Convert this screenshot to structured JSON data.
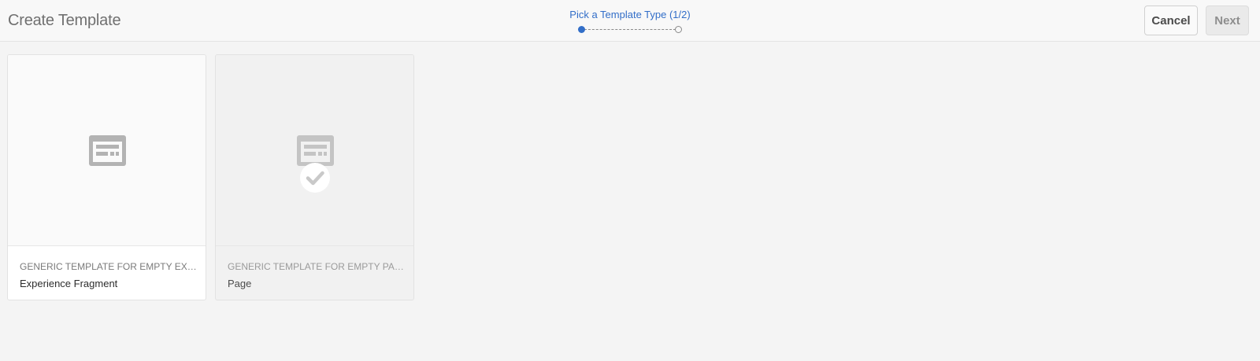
{
  "header": {
    "title": "Create Template",
    "step_label": "Pick a Template Type (1/2)",
    "steps": [
      "completed",
      "pending"
    ],
    "cancel_label": "Cancel",
    "next_label": "Next"
  },
  "cards": [
    {
      "icon": "template-icon",
      "subtitle": "GENERIC TEMPLATE FOR EMPTY EXPER...",
      "name": "Experience Fragment",
      "selected": false
    },
    {
      "icon": "template-icon",
      "subtitle": "GENERIC TEMPLATE FOR EMPTY PAGES...",
      "name": "Page",
      "selected": true
    }
  ],
  "colors": {
    "accent": "#326ec8",
    "background": "#f4f4f4"
  }
}
